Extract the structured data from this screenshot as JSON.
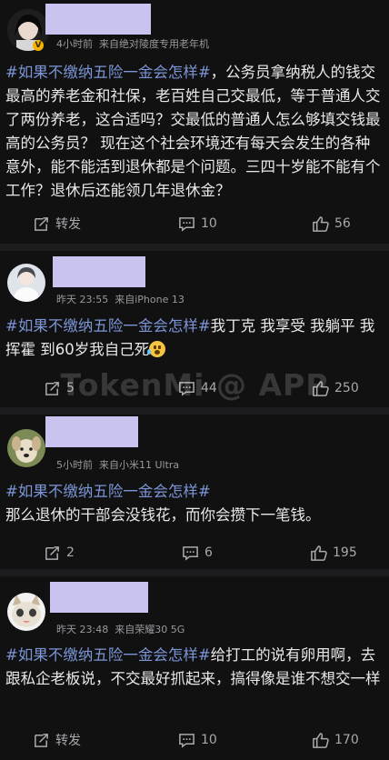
{
  "watermark": "TokenMi @ APP",
  "posts": [
    {
      "meta_time": "4小时前",
      "meta_device": "来自绝对陵度专用老年机",
      "hashtag": "#如果不缴纳五险一金会怎样#",
      "text": "，公务员拿纳税人的钱交最高的养老金和社保，老百姓自己交最低，等于普通人交了两份养老，这合适吗？交最低的普通人怎么够填交钱最高的公务员？ 现在这个社会环境还有每天会发生的各种意外，能不能活到退休都是个问题。三四十岁能不能有个工作？退休后还能领几年退休金？",
      "repost": "转发",
      "comments": "10",
      "likes": "56"
    },
    {
      "meta_time": "昨天 23:55",
      "meta_device": "来自iPhone 13",
      "hashtag": "#如果不缴纳五险一金会怎样#",
      "text": "我丁克 我享受 我躺平 我挥霍 到60岁我自己死",
      "repost": "5",
      "comments": "44",
      "likes": "250"
    },
    {
      "meta_time": "5小时前",
      "meta_device": "来自小米11 Ultra",
      "hashtag": "#如果不缴纳五险一金会怎样#",
      "text": "那么退休的干部会没钱花，而你会攒下一笔钱。",
      "repost": "2",
      "comments": "6",
      "likes": "195"
    },
    {
      "meta_time": "昨天 23:48",
      "meta_device": "来自荣耀30 5G",
      "hashtag": "#如果不缴纳五险一金会怎样#",
      "text": "给打工的说有卵用啊，去跟私企老板说，不交最好抓起来，搞得像是谁不想交一样",
      "repost": "转发",
      "comments": "10",
      "likes": "170"
    }
  ]
}
